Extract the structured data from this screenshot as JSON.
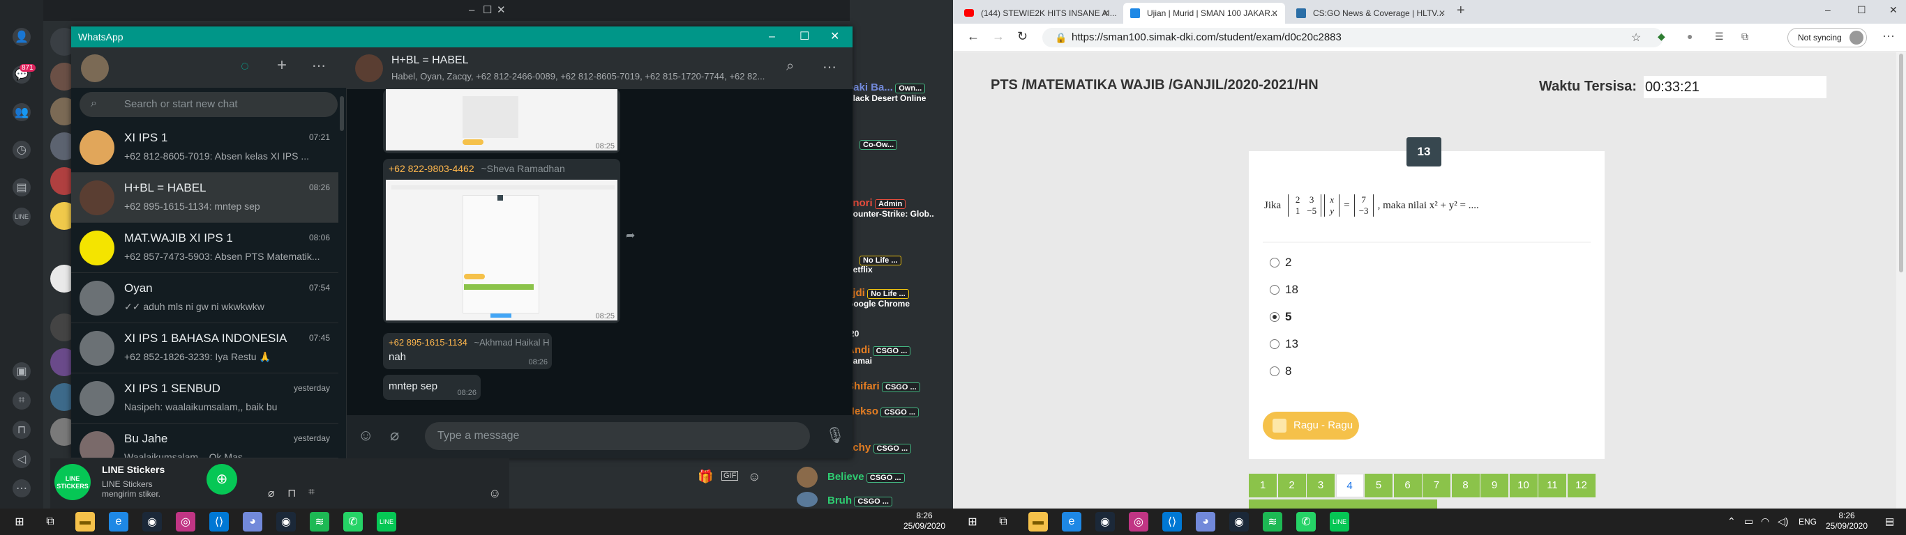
{
  "left": {
    "right_panel": {
      "groups": [
        {
          "name": "oaki Ba...",
          "tag": "Own...",
          "sub": "Black Desert Online"
        },
        {
          "name": "",
          "tag": "Co-Ow...",
          "sub": ""
        },
        {
          "name": "1nori",
          "tag": "Admin",
          "sub": "Counter-Strike: Glob.."
        },
        {
          "name": "",
          "tag": "No Life ...",
          "sub": "Netflix"
        },
        {
          "name": "ajdi",
          "tag": "No Life ...",
          "sub": "Google Chrome"
        },
        {
          "name": "-20",
          "tag": "",
          "sub": ""
        },
        {
          "name": "Andi",
          "tag": "CSGO ...",
          "sub": "Damai"
        },
        {
          "name": "Shifari",
          "tag": "CSGO ...",
          "sub": ""
        },
        {
          "name": "Nekso",
          "tag": "CSGO ...",
          "sub": ""
        },
        {
          "name": "achy",
          "tag": "CSGO ...",
          "sub": ""
        },
        {
          "name": "Believe",
          "tag": "CSGO ...",
          "sub": ""
        },
        {
          "name": "Bruh",
          "tag": "CSGO ...",
          "sub": ""
        }
      ],
      "badge": "871"
    },
    "whatsapp": {
      "title": "WhatsApp",
      "search_placeholder": "Search or start new chat",
      "chats": [
        {
          "name": "XI IPS 1",
          "time": "07:21",
          "msg": "+62 812-8605-7019: Absen kelas XI IPS ..."
        },
        {
          "name": "H+BL = HABEL",
          "time": "08:26",
          "msg": "+62 895-1615-1134: mntep sep"
        },
        {
          "name": "MAT.WAJIB XI IPS 1",
          "time": "08:06",
          "msg": "+62 857-7473-5903: Absen PTS Matematik..."
        },
        {
          "name": "Oyan",
          "time": "07:54",
          "msg": "✓✓ aduh mls ni gw ni wkwkwkw"
        },
        {
          "name": "XI IPS 1 BAHASA INDONESIA",
          "time": "07:45",
          "msg": "+62 852-1826-3239: Iya Restu 🙏"
        },
        {
          "name": "XI IPS 1 SENBUD",
          "time": "yesterday",
          "msg": "Nasipeh: waalaikumsalam,, baik bu"
        },
        {
          "name": "Bu Jahe",
          "time": "yesterday",
          "msg": "Waalaikumsalam... Ok Mas"
        }
      ],
      "conversation": {
        "name": "H+BL = HABEL",
        "members": "Habel, Oyan, Zacqy, +62 812-2466-0089, +62 812-8605-7019, +62 815-1720-7744, +62 82...",
        "img1_time": "08:25",
        "sender2": "+62 822-9803-4462",
        "sender2_name": "~Sheva Ramadhan",
        "img2_time": "08:25",
        "sender3": "+62 895-1615-1134",
        "sender3_name": "~Akhmad Haikal H",
        "msg3": "nah",
        "msg3_time": "08:26",
        "msg4": "mntep sep",
        "msg4_time": "08:26"
      },
      "compose_placeholder": "Type a message"
    },
    "line": {
      "title": "LINE Stickers",
      "subtitle": "LINE Stickers mengirim stiker.",
      "logo": "LINE STICKERS"
    },
    "taskbar": {
      "time": "8:26",
      "date": "25/09/2020"
    }
  },
  "right": {
    "tabs": [
      {
        "label": "(144) STEWIE2K HITS INSANE AI...",
        "icon_color": "#ff0000"
      },
      {
        "label": "Ujian | Murid | SMAN 100 JAKAR...",
        "icon_color": "#1e88e5"
      },
      {
        "label": "CS:GO News & Coverage | HLTV...",
        "icon_color": "#2b6ea6"
      }
    ],
    "url": "https://sman100.simak-dki.com/student/exam/d0c20c2883",
    "not_syncing": "Not syncing",
    "exam": {
      "title": "PTS /MATEMATIKA WAJIB /GANJIL/2020-2021/HN",
      "time_label": "Waktu Tersisa:",
      "time_value": "00:33:21",
      "question_number": "13",
      "question_prefix": "Jika",
      "matrix_a": [
        "2",
        "3",
        "1",
        "−5"
      ],
      "vector_x": [
        "x",
        "y"
      ],
      "vector_b": [
        "7",
        "−3"
      ],
      "question_suffix": ", maka nilai x² + y² = ....",
      "options": [
        "2",
        "18",
        "5",
        "13",
        "8"
      ],
      "selected_index": 2,
      "ragu_label": "Ragu - Ragu",
      "numbers": [
        "1",
        "2",
        "3",
        "4",
        "5",
        "6",
        "7",
        "8",
        "9",
        "10",
        "11",
        "12"
      ],
      "current_number": 3
    },
    "taskbar": {
      "lang": "ENG",
      "time": "8:26",
      "date": "25/09/2020"
    }
  }
}
